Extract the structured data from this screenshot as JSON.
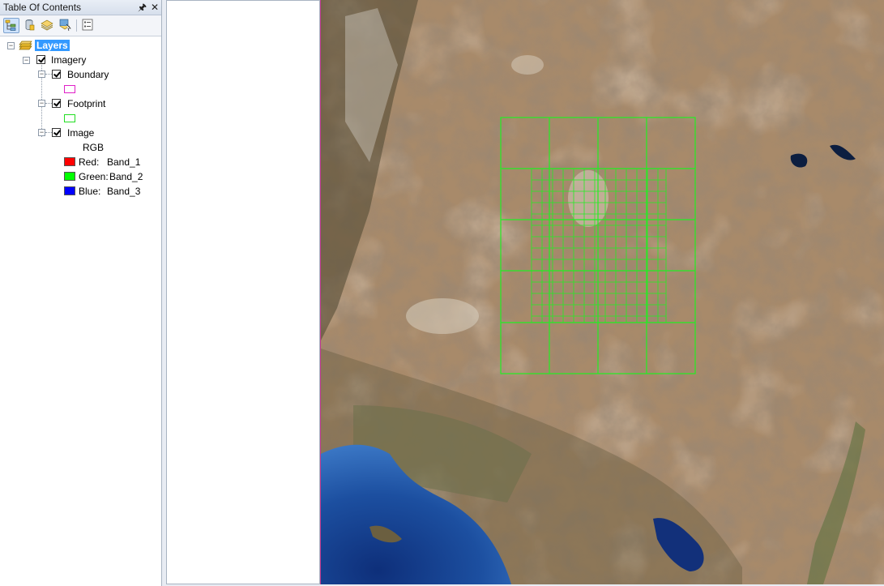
{
  "toc": {
    "title": "Table Of Contents",
    "toolbar": [
      {
        "name": "list-by-drawing-order-icon",
        "active": true
      },
      {
        "name": "list-by-source-icon",
        "active": false
      },
      {
        "name": "list-by-visibility-icon",
        "active": false
      },
      {
        "name": "list-by-selection-icon",
        "active": false
      },
      {
        "name": "options-icon",
        "active": false
      }
    ],
    "tree": {
      "root_label": "Layers",
      "group_label": "Imagery",
      "boundary_label": "Boundary",
      "footprint_label": "Footprint",
      "image_label": "Image",
      "rgb_label": "RGB",
      "bands": [
        {
          "channel": "Red:",
          "band": "Band_1",
          "color": "#ff0000"
        },
        {
          "channel": "Green:",
          "band": "Band_2",
          "color": "#00ff00"
        },
        {
          "channel": "Blue:",
          "band": "Band_3",
          "color": "#0000ff"
        }
      ],
      "boundary_color": "#e020c8",
      "footprint_color": "#22dd22"
    }
  },
  "map": {
    "footprint_color": "#22ee22",
    "layer_extent_color": "#c0398f"
  }
}
